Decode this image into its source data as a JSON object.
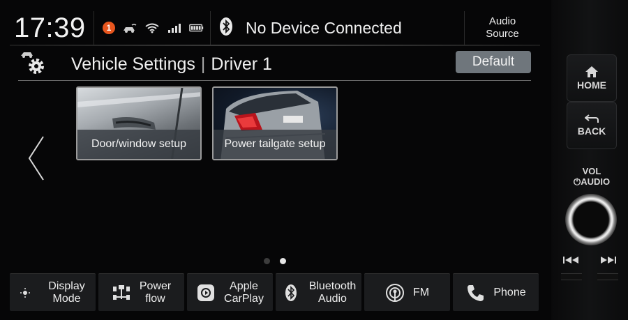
{
  "status_bar": {
    "time": "17:39",
    "notification_count": "1",
    "device_status": "No Device Connected",
    "audio_source_line1": "Audio",
    "audio_source_line2": "Source"
  },
  "header": {
    "title": "Vehicle Settings",
    "profile": "Driver 1",
    "default_label": "Default"
  },
  "tiles": [
    {
      "label": "Door/window setup",
      "icon": "car-door-photo"
    },
    {
      "label": "Power tailgate setup",
      "icon": "tailgate-photo"
    }
  ],
  "pagination": {
    "total": 2,
    "active": 2
  },
  "bottom_nav": [
    {
      "line1": "Display",
      "line2": "Mode",
      "icon": "display-mode-icon"
    },
    {
      "line1": "Power",
      "line2": "flow",
      "icon": "power-flow-icon"
    },
    {
      "line1": "Apple",
      "line2": "CarPlay",
      "icon": "carplay-icon"
    },
    {
      "line1": "Bluetooth",
      "line2": "Audio",
      "icon": "bluetooth-icon"
    },
    {
      "line1": "FM",
      "line2": "",
      "icon": "radio-icon"
    },
    {
      "line1": "Phone",
      "line2": "",
      "icon": "phone-icon"
    }
  ],
  "hardware": {
    "home_label": "HOME",
    "back_label": "BACK",
    "vol_label": "VOL",
    "audio_label": "AUDIO"
  },
  "colors": {
    "accent_badge": "#e8561e",
    "default_button": "#6f767c",
    "background": "#060607"
  }
}
